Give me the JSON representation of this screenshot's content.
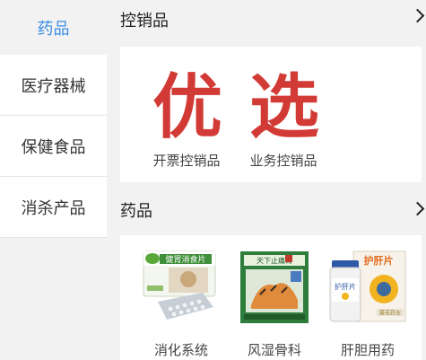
{
  "sidebar": {
    "items": [
      {
        "label": "药品",
        "active": true
      },
      {
        "label": "医疗器械",
        "active": false
      },
      {
        "label": "保健食品",
        "active": false
      },
      {
        "label": "消杀产品",
        "active": false
      }
    ]
  },
  "sections": {
    "controlled": {
      "title": "控销品",
      "items": [
        {
          "glyph": "优",
          "label": "开票控销品"
        },
        {
          "glyph": "选",
          "label": "业务控销品"
        }
      ]
    },
    "drugs": {
      "title": "药品",
      "items": [
        {
          "label": "消化系统",
          "pack_text": "健胃消食片"
        },
        {
          "label": "风湿骨科",
          "pack_text": "天下止痛膏"
        },
        {
          "label": "肝胆用药",
          "pack_text": "护肝片",
          "pack_subtext": "葵花药业"
        }
      ]
    }
  },
  "colors": {
    "accent": "#3a8ee6",
    "promo_red": "#d23b35"
  }
}
